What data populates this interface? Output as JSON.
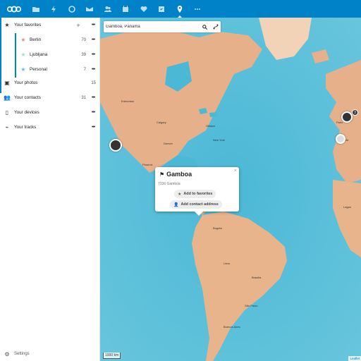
{
  "header": {
    "logo": "nextcloud-logo",
    "nav": [
      {
        "name": "files-icon",
        "active": false
      },
      {
        "name": "activity-icon",
        "active": false
      },
      {
        "name": "talk-icon",
        "active": false
      },
      {
        "name": "mail-icon",
        "active": false
      },
      {
        "name": "contacts-icon",
        "active": false
      },
      {
        "name": "calendar-icon",
        "active": false
      },
      {
        "name": "favorites-icon",
        "active": false
      },
      {
        "name": "tasks-icon",
        "active": false
      },
      {
        "name": "maps-icon",
        "active": true
      },
      {
        "name": "more-apps-icon",
        "active": false
      }
    ]
  },
  "sidebar": {
    "favorites": {
      "label": "Your favorites",
      "more": "•••",
      "add": "+"
    },
    "favorite_items": [
      {
        "label": "Berlin",
        "count": "70",
        "star_color": "#e8888e",
        "more": "•••"
      },
      {
        "label": "Ljubljana",
        "count": "39",
        "star_color": "#9fe0c8",
        "more": "•••"
      },
      {
        "label": "Personal",
        "count": "7",
        "star_color": "#6fb4e8",
        "more": "•••"
      }
    ],
    "photos": {
      "label": "Your photos",
      "count": "15"
    },
    "contacts": {
      "label": "Your contacts",
      "count": "31",
      "more": "•••"
    },
    "devices": {
      "label": "Your devices",
      "more": "•••"
    },
    "tracks": {
      "label": "Your tracks",
      "more": "•••"
    },
    "settings": "Settings"
  },
  "map": {
    "search": {
      "value": "Gamboa, Panama"
    },
    "popup": {
      "title": "Gamboa",
      "subtitle": "7336 Gamboa",
      "add_favorites": "Add to favorites",
      "add_contact": "Add contact address",
      "close": "×"
    },
    "cluster_count": "3",
    "scale": "1000 km",
    "attribution": "Leaflet"
  },
  "colors": {
    "brand": "#0082c9",
    "water": "#5fc0d8",
    "land": "#e8b48c"
  }
}
